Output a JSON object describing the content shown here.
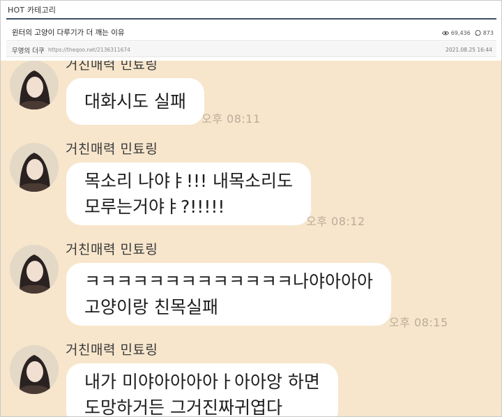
{
  "category": {
    "title": "HOT 카테고리"
  },
  "post": {
    "title": "윈터의 고양이 다루기가 더 깨는 이유",
    "views": "69,436",
    "comments": "873",
    "author": "무명의 더쿠",
    "link": "https://theqoo.net/2136311674",
    "date": "2021.08.25 16:44"
  },
  "chat": {
    "messages": [
      {
        "sender": "거친매력 민툐링",
        "lines": [
          "대화시도 실패"
        ],
        "time": "오후 08:11"
      },
      {
        "sender": "거친매력 민툐링",
        "lines": [
          "목소리 나야ㅑ!!! 내목소리도",
          "모루는거야ㅑ?!!!!!"
        ],
        "time": "오후 08:12"
      },
      {
        "sender": "거친매력 민툐링",
        "lines": [
          "ㅋㅋㅋㅋㅋㅋㅋㅋㅋㅋㅋㅋㅋ나야아아아",
          "고양이랑 친목실패"
        ],
        "time": "오후 08:15"
      },
      {
        "sender": "거친매력 민툐링",
        "lines": [
          "내가 미야아아아아ㅏ아아앙 하면",
          "도망하거든 그거진짜귀엽다"
        ],
        "time": ""
      }
    ]
  },
  "colors": {
    "chat_bg": "#f7e6cc",
    "bubble": "#ffffff",
    "header_rule": "#3d4f66",
    "time": "#b9ad9a"
  },
  "icons": {
    "views": "eye-icon",
    "comments": "comment-icon",
    "avatar": "profile-photo"
  }
}
